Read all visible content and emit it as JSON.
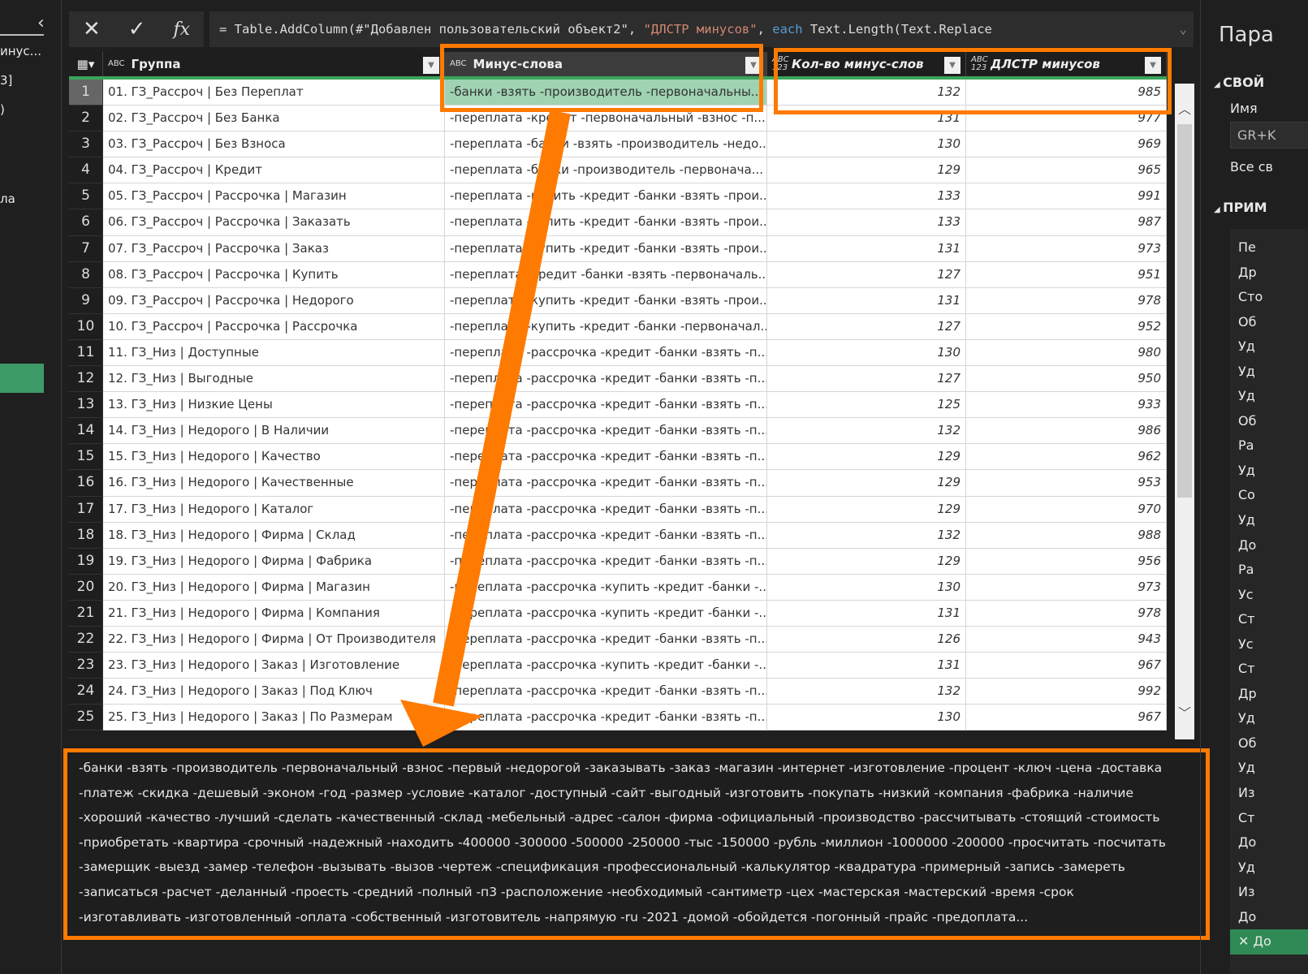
{
  "left_panel": {
    "fragments": [
      "инус...",
      "3]",
      ")",
      "ла"
    ]
  },
  "formula_bar": {
    "cancel_icon": "close-icon",
    "commit_icon": "check-icon",
    "fx_label": "fx",
    "prefix": "= Table.AddColumn(#\"Добавлен пользовательский объект2\", ",
    "string": "\"ДЛСТР минусов\"",
    "comma": ", ",
    "keyword": "each",
    "suffix": " Text.Length(Text.Replace"
  },
  "table": {
    "columns": [
      {
        "type": "ABC",
        "name": "Группа"
      },
      {
        "type": "ABC",
        "name": "Минус-слова"
      },
      {
        "type": "ABC 123",
        "name": "Кол-во минус-слов"
      },
      {
        "type": "ABC 123",
        "name": "ДЛСТР минусов"
      }
    ],
    "rows": [
      {
        "n": "1",
        "group": "01. ГЗ_Рассроч | Без Переплат",
        "minus": "-банки -взять -производитель -первоначальны...",
        "count": "132",
        "len": "985"
      },
      {
        "n": "2",
        "group": "02. ГЗ_Рассроч | Без Банка",
        "minus": "-переплата -кредит -первоначальный -взнос -п...",
        "count": "131",
        "len": "977"
      },
      {
        "n": "3",
        "group": "03. ГЗ_Рассроч | Без Взноса",
        "minus": "-переплата -банки -взять -производитель -недо...",
        "count": "130",
        "len": "969"
      },
      {
        "n": "4",
        "group": "04. ГЗ_Рассроч | Кредит",
        "minus": "-переплата -банки -производитель -первонача...",
        "count": "129",
        "len": "965"
      },
      {
        "n": "5",
        "group": "05. ГЗ_Рассроч | Рассрочка | Магазин",
        "minus": "-переплата -купить -кредит -банки -взять -прои...",
        "count": "133",
        "len": "991"
      },
      {
        "n": "6",
        "group": "06. ГЗ_Рассроч | Рассрочка | Заказать",
        "minus": "-переплата -купить -кредит -банки -взять -прои...",
        "count": "133",
        "len": "987"
      },
      {
        "n": "7",
        "group": "07. ГЗ_Рассроч | Рассрочка | Заказ",
        "minus": "-переплата -купить -кредит -банки -взять -прои...",
        "count": "131",
        "len": "973"
      },
      {
        "n": "8",
        "group": "08. ГЗ_Рассроч | Рассрочка | Купить",
        "minus": "-переплата -кредит -банки -взять -первоначаль...",
        "count": "127",
        "len": "951"
      },
      {
        "n": "9",
        "group": "09. ГЗ_Рассроч | Рассрочка | Недорого",
        "minus": "-переплата -купить -кредит -банки -взять -прои...",
        "count": "131",
        "len": "978"
      },
      {
        "n": "10",
        "group": "10. ГЗ_Рассроч | Рассрочка | Рассрочка",
        "minus": "-переплата -купить -кредит -банки -первоначал...",
        "count": "127",
        "len": "952"
      },
      {
        "n": "11",
        "group": "11. ГЗ_Низ | Доступные",
        "minus": "-переплата -рассрочка -кредит -банки -взять -п...",
        "count": "130",
        "len": "980"
      },
      {
        "n": "12",
        "group": "12. ГЗ_Низ | Выгодные",
        "minus": "-переплата -рассрочка -кредит -банки -взять -п...",
        "count": "127",
        "len": "950"
      },
      {
        "n": "13",
        "group": "13. ГЗ_Низ | Низкие Цены",
        "minus": "-переплата -рассрочка -кредит -банки -взять -п...",
        "count": "125",
        "len": "933"
      },
      {
        "n": "14",
        "group": "14. ГЗ_Низ | Недорого | В Наличии",
        "minus": "-переплата -рассрочка -кредит -банки -взять -п...",
        "count": "132",
        "len": "986"
      },
      {
        "n": "15",
        "group": "15. ГЗ_Низ | Недорого | Качество",
        "minus": "-переплата -рассрочка -кредит -банки -взять -п...",
        "count": "129",
        "len": "962"
      },
      {
        "n": "16",
        "group": "16. ГЗ_Низ | Недорого | Качественные",
        "minus": "-переплата -рассрочка -кредит -банки -взять -п...",
        "count": "129",
        "len": "953"
      },
      {
        "n": "17",
        "group": "17. ГЗ_Низ | Недорого | Каталог",
        "minus": "-переплата -рассрочка -кредит -банки -взять -п...",
        "count": "129",
        "len": "970"
      },
      {
        "n": "18",
        "group": "18. ГЗ_Низ | Недорого | Фирма | Склад",
        "minus": "-переплата -рассрочка -кредит -банки -взять -п...",
        "count": "132",
        "len": "988"
      },
      {
        "n": "19",
        "group": "19. ГЗ_Низ | Недорого | Фирма | Фабрика",
        "minus": "-переплата -рассрочка -кредит -банки -взять -п...",
        "count": "129",
        "len": "956"
      },
      {
        "n": "20",
        "group": "20. ГЗ_Низ | Недорого | Фирма | Магазин",
        "minus": "-переплата -рассрочка -купить -кредит -банки -...",
        "count": "130",
        "len": "973"
      },
      {
        "n": "21",
        "group": "21. ГЗ_Низ | Недорого | Фирма | Компания",
        "minus": "-переплата -рассрочка -купить -кредит -банки -...",
        "count": "131",
        "len": "978"
      },
      {
        "n": "22",
        "group": "22. ГЗ_Низ | Недорого | Фирма | От Производителя",
        "minus": "-переплата -рассрочка -кредит -банки -взять -п...",
        "count": "126",
        "len": "943"
      },
      {
        "n": "23",
        "group": "23. ГЗ_Низ | Недорого | Заказ | Изготовление",
        "minus": "-переплата -рассрочка -купить -кредит -банки -...",
        "count": "131",
        "len": "967"
      },
      {
        "n": "24",
        "group": "24. ГЗ_Низ | Недорого | Заказ | Под Ключ",
        "minus": "-переплата -рассрочка -кредит -банки -взять -п...",
        "count": "132",
        "len": "992"
      },
      {
        "n": "25",
        "group": "25. ГЗ_Низ | Недорого | Заказ | По Размерам",
        "minus": "-переплата -рассрочка -кредит -банки -взять -п...",
        "count": "130",
        "len": "967"
      }
    ]
  },
  "preview": {
    "lines": [
      "-банки -взять -производитель -первоначальный -взнос -первый -недорогой -заказывать -заказ -магазин -интернет -изготовление -процент -ключ -цена -доставка",
      "-платеж -скидка -дешевый -эконом -год -размер -условие -каталог -доступный -сайт -выгодный -изготовить -покупать -низкий -компания -фабрика -наличие",
      "-хороший -качество -лучший -сделать -качественный -склад -мебельный -адрес -салон -фирма -официальный -производство -рассчитывать -стоящий -стоимость",
      "-приобретать -квартира -срочный -надежный -находить -400000 -300000 -500000 -250000 -тыс -150000 -рубль -миллион -1000000 -200000 -просчитать -посчитать",
      "-замерщик -выезд -замер -телефон -вызывать -вызов -чертеж -спецификация -профессиональный -калькулятор -квадратура -примерный -запись -замереть",
      "-записаться -расчет -деланный -проесть -средний -полный -п3 -расположение -необходимый -сантиметр -цех -мастерская -мастерский -время -срок",
      "-изготавливать -изготовленный -оплата -собственный -изготовитель -напрямую -ru -2021 -домой -обойдется -погонный -прайс -предоплата..."
    ]
  },
  "right_panel": {
    "title": "Пара",
    "section_props": "СВОЙ",
    "name_label": "Имя",
    "name_value": "GR+K",
    "all_props": "Все св",
    "section_steps": "ПРИМ",
    "steps": [
      "Пе",
      "Др",
      "Сто",
      "Об",
      "Уд",
      "Уд",
      "Уд",
      "Об",
      "Ра",
      "Уд",
      "Со",
      "Уд",
      "До",
      "Ра",
      "Ус",
      "Ст",
      "Ус",
      "Ст",
      "Др",
      "Уд",
      "Об",
      "Уд",
      "Из",
      "Ст",
      "До",
      "Уд",
      "Из",
      "До",
      "✕ До"
    ]
  },
  "colors": {
    "accent": "#ff7a00",
    "green": "#3aa55c",
    "selected_cell": "#9fd3b2"
  }
}
